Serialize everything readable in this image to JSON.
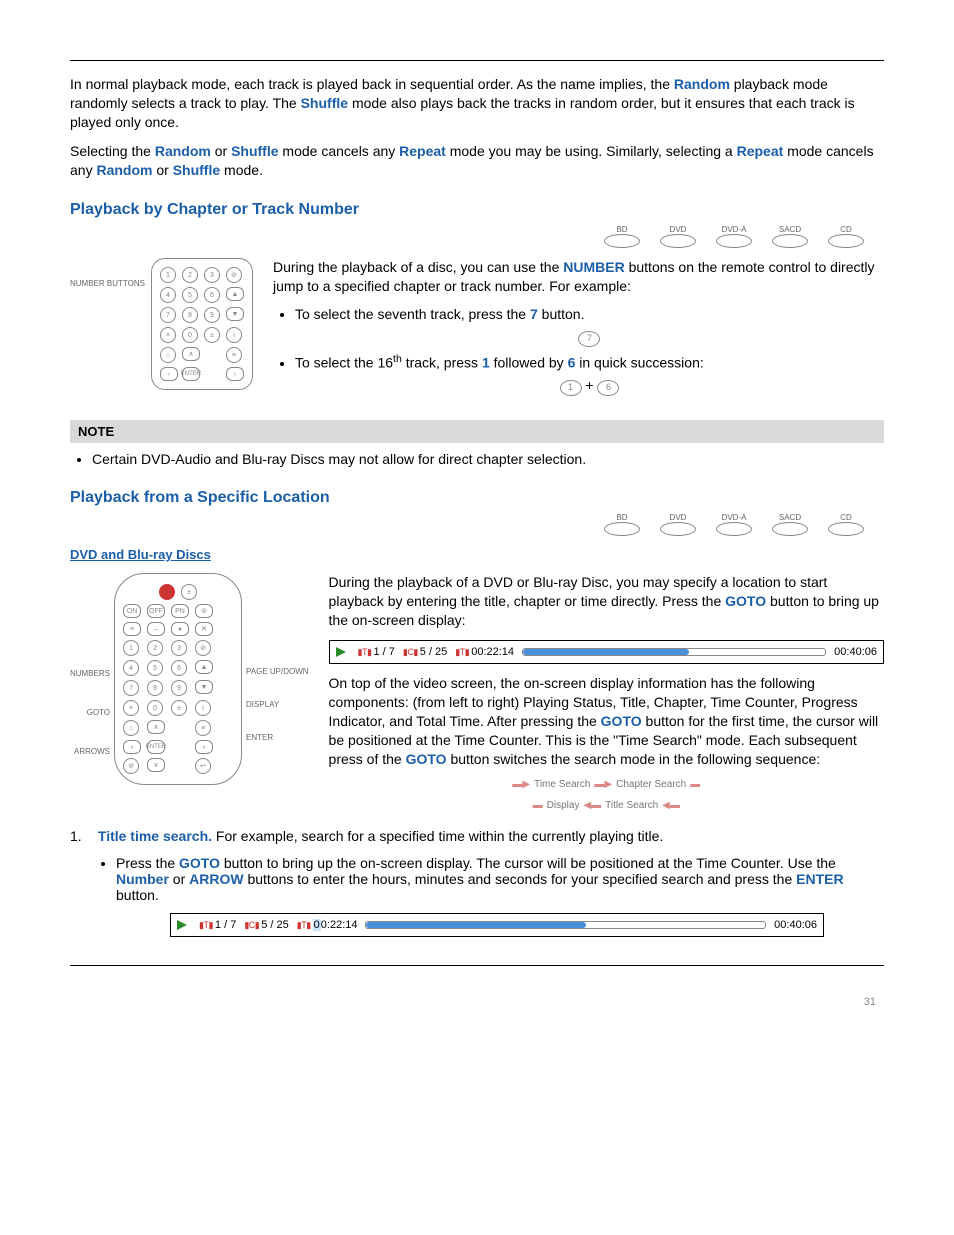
{
  "intro": {
    "p1a": "In normal playback mode, each track is played back in sequential order.  As the name implies, the ",
    "random": "Random",
    "p1b": " playback mode randomly selects a track to play.  The ",
    "shuffle": "Shuffle",
    "p1c": " mode also plays back the tracks in random order, but it ensures that each track is played only once.",
    "p2a": "Selecting the ",
    "p2b": " or ",
    "p2c": " mode cancels any ",
    "repeat": "Repeat",
    "p2d": " mode you may be using.  Similarly, selecting a ",
    "p2e": " mode cancels any ",
    "p2f": " or ",
    "p2g": " mode."
  },
  "section1": {
    "title": "Playback by Chapter or Track Number",
    "discs": [
      "BD",
      "DVD",
      "DVD-A",
      "SACD",
      "CD"
    ],
    "label_numbers": "NUMBER BUTTONS",
    "p1a": "During the playback of a disc, you can use the ",
    "number_b": "NUMBER",
    "p1b": " buttons on the remote control to directly jump to a specified chapter or track number.  For example:",
    "li1a": "To select the seventh track, press the ",
    "seven": "7",
    "li1b": " button.",
    "li2a": "To select the 16",
    "th": "th",
    "li2b": " track, press ",
    "one": "1",
    "followed": " followed by ",
    "six": "6",
    "li2c": " in quick succession:",
    "plus": " + ",
    "notehead": "NOTE",
    "note1": "Certain DVD-Audio and Blu-ray Discs may not allow for direct chapter selection."
  },
  "section2": {
    "title": "Playback from a Specific Location",
    "sub": "DVD and Blu-ray Discs",
    "discs": [
      "BD",
      "DVD",
      "DVD-A",
      "SACD",
      "CD"
    ],
    "labels": {
      "numbers": "NUMBERS",
      "goto": "GOTO",
      "arrows": "ARROWS",
      "page": "PAGE UP/DOWN",
      "display": "DISPLAY",
      "enter": "ENTER"
    },
    "p1a": "During the playback of a DVD or Blu-ray Disc, you may specify a location to start playback by entering the title, chapter or time directly.  Press the ",
    "goto_b": "GOTO",
    "p1b": " button to bring up the on-screen display:",
    "p2a": "On top of the video screen, the on-screen display information has the following components: (from left to right) Playing Status, Title, Chapter, Time Counter, Progress Indicator, and Total Time.  After pressing the ",
    "p2b": " button for the first time, the cursor will be positioned at the Time Counter.  This is the \"Time Search\" mode.  Each subsequent press of the ",
    "p2c": " button switches the search mode in the following sequence:",
    "seq": [
      "Time Search",
      "Chapter Search",
      "Display",
      "Title Search"
    ],
    "step1n": "1.",
    "step1a": "Title time search.",
    "step1b": " For example, search for a specified time within the currently playing title.",
    "bp1a": "Press the ",
    "bp1b": " button to bring up the on-screen display.  The cursor will be positioned at the Time Counter.  Use the ",
    "number_b": "Number",
    "bp1c": " or ",
    "arrow_b": "ARROW",
    "bp1d": " buttons to enter the hours, minutes and seconds for your specified search and press the ",
    "enter_b": "ENTER",
    "bp1e": " button.",
    "title_counter": "1 / 7",
    "chapter_counter": "5 / 25",
    "time1": "00:22:14",
    "time2": "00:40:06",
    "t_icon": "T",
    "c_icon": "C",
    "t2_icon": "T"
  }
}
